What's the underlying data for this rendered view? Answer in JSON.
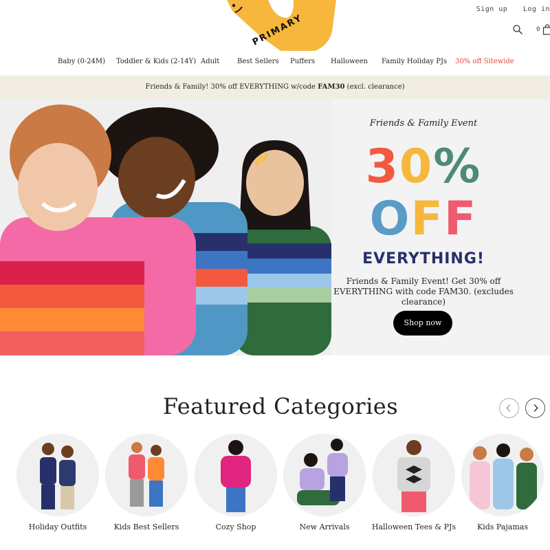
{
  "brand": {
    "name": "PRIMARY",
    "color": "#f6b73c"
  },
  "account": {
    "sign_up": "Sign up",
    "log_in": "Log in"
  },
  "cart": {
    "count": "0"
  },
  "nav": {
    "items": [
      {
        "label": "Baby (0-24M)"
      },
      {
        "label": "Toddler & Kids (2-14Y)"
      },
      {
        "label": "Adult"
      },
      {
        "label": "Best Sellers"
      },
      {
        "label": "Puffers"
      },
      {
        "label": "Halloween"
      },
      {
        "label": "Family Holiday PJs"
      },
      {
        "label": "30% off Sitewide",
        "color": "#e0483b"
      }
    ]
  },
  "promo": {
    "text_before": "Friends & Family! 30% off EVERYTHING w/code ",
    "code": "FAM30",
    "text_after": " (excl. clearance)"
  },
  "hero": {
    "event_label": "Friends & Family Event",
    "headline_percent": "30%",
    "headline_off": "OFF",
    "headline_everything": "EVERYTHING!",
    "subtext": "Friends & Family Event! Get 30% off EVERYTHING with code FAM30. (excludes clearance)",
    "cta": "Shop now",
    "colors": {
      "three": "#f2593f",
      "zero": "#f6b73c",
      "percent": "#4e8a78",
      "O": "#5b9bc7",
      "F1": "#f6b73c",
      "F2": "#f05a6e",
      "everything": "#27306b"
    }
  },
  "featured": {
    "title": "Featured Categories",
    "categories": [
      {
        "label": "Holiday Outfits"
      },
      {
        "label": "Kids Best Sellers"
      },
      {
        "label": "Cozy Shop"
      },
      {
        "label": "New Arrivals"
      },
      {
        "label": "Halloween Tees & PJs"
      },
      {
        "label": "Kids Pajamas"
      }
    ]
  }
}
